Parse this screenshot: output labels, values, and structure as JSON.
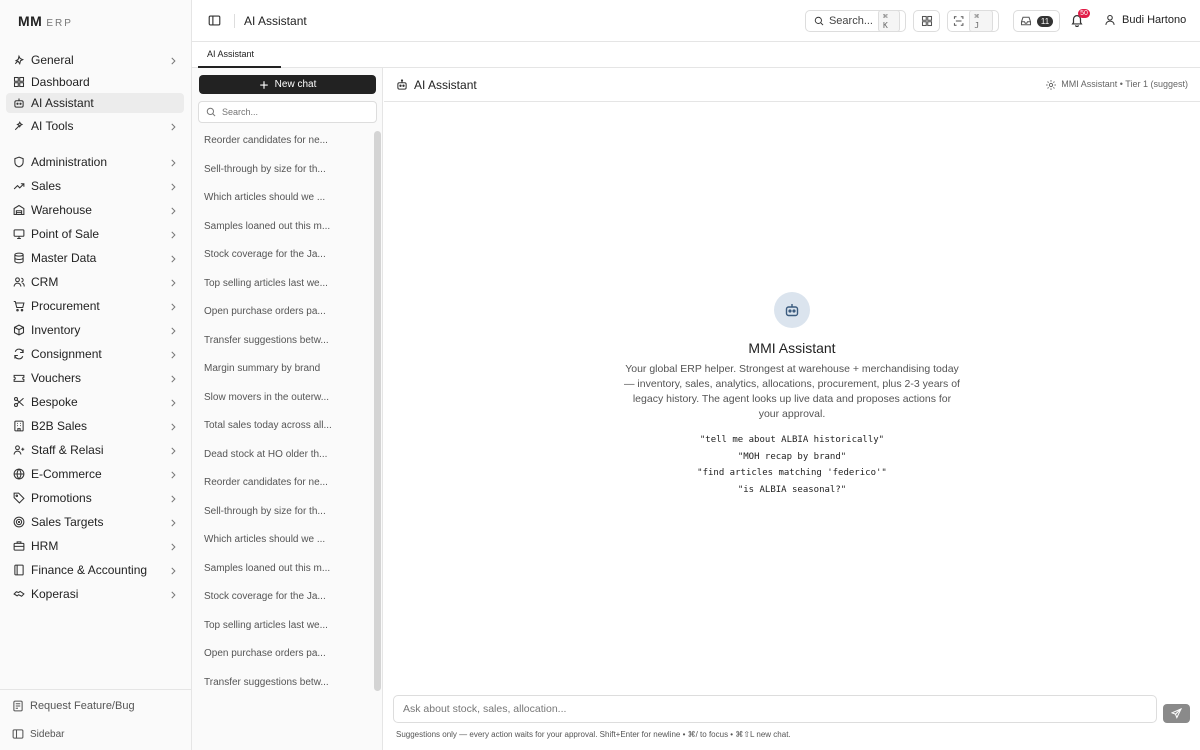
{
  "logo": {
    "main": "MM",
    "sub": "ERP"
  },
  "nav": [
    {
      "label": "General",
      "icon": "general-icon",
      "chevron": true,
      "active": false
    },
    {
      "label": "Dashboard",
      "icon": "dashboard-icon",
      "chevron": false,
      "active": false
    },
    {
      "label": "AI Assistant",
      "icon": "bot-icon",
      "chevron": false,
      "active": true
    },
    {
      "label": "AI Tools",
      "icon": "ai-tools-icon",
      "chevron": true,
      "active": false
    },
    {
      "label": "Administration",
      "icon": "shield-icon",
      "chevron": true,
      "active": false
    },
    {
      "label": "Sales",
      "icon": "trend-icon",
      "chevron": true,
      "active": false
    },
    {
      "label": "Warehouse",
      "icon": "warehouse-icon",
      "chevron": true,
      "active": false
    },
    {
      "label": "Point of Sale",
      "icon": "monitor-icon",
      "chevron": true,
      "active": false
    },
    {
      "label": "Master Data",
      "icon": "database-icon",
      "chevron": true,
      "active": false
    },
    {
      "label": "CRM",
      "icon": "users-icon",
      "chevron": true,
      "active": false
    },
    {
      "label": "Procurement",
      "icon": "cart-icon",
      "chevron": true,
      "active": false
    },
    {
      "label": "Inventory",
      "icon": "box-icon",
      "chevron": true,
      "active": false
    },
    {
      "label": "Consignment",
      "icon": "refresh-icon",
      "chevron": true,
      "active": false
    },
    {
      "label": "Vouchers",
      "icon": "ticket-icon",
      "chevron": true,
      "active": false
    },
    {
      "label": "Bespoke",
      "icon": "scissors-icon",
      "chevron": true,
      "active": false
    },
    {
      "label": "B2B Sales",
      "icon": "building-icon",
      "chevron": true,
      "active": false
    },
    {
      "label": "Staff & Relasi",
      "icon": "user-plus-icon",
      "chevron": true,
      "active": false
    },
    {
      "label": "E-Commerce",
      "icon": "globe-icon",
      "chevron": true,
      "active": false
    },
    {
      "label": "Promotions",
      "icon": "tag-icon",
      "chevron": true,
      "active": false
    },
    {
      "label": "Sales Targets",
      "icon": "target-icon",
      "chevron": true,
      "active": false
    },
    {
      "label": "HRM",
      "icon": "briefcase-icon",
      "chevron": true,
      "active": false
    },
    {
      "label": "Finance & Accounting",
      "icon": "ledger-icon",
      "chevron": true,
      "active": false
    },
    {
      "label": "Koperasi",
      "icon": "handshake-icon",
      "chevron": true,
      "active": false
    }
  ],
  "bottom": {
    "feature": "Request Feature/Bug",
    "sidebar": "Sidebar"
  },
  "header": {
    "title": "AI Assistant",
    "search_label": "Search...",
    "search_kbd": "⌘ K",
    "focus_kbd": "⌘ J",
    "inbox_count": "11",
    "notif_count": "50",
    "user": "Budi Hartono"
  },
  "tabs": [
    {
      "label": "AI Assistant"
    }
  ],
  "chatlist": {
    "new_chat": "New chat",
    "search_placeholder": "Search...",
    "items": [
      "Total sales today across all...",
      "Dead stock at HO older th...",
      "Reorder candidates for ne...",
      "Sell-through by size for th...",
      "Which articles should we ...",
      "Samples loaned out this m...",
      "Stock coverage for the Ja...",
      "Top selling articles last we...",
      "Open purchase orders pa...",
      "Transfer suggestions betw...",
      "Margin summary by brand",
      "Slow movers in the outerw...",
      "Total sales today across all...",
      "Dead stock at HO older th...",
      "Reorder candidates for ne...",
      "Sell-through by size for th...",
      "Which articles should we ...",
      "Samples loaned out this m...",
      "Stock coverage for the Ja...",
      "Top selling articles last we...",
      "Open purchase orders pa...",
      "Transfer suggestions betw..."
    ]
  },
  "main": {
    "title": "AI Assistant",
    "tier": "MMI Assistant • Tier 1 (suggest)",
    "hero_title": "MMI Assistant",
    "hero_desc": "Your global ERP helper. Strongest at warehouse + merchandising today — inventory, sales, analytics, allocations, procurement, plus 2-3 years of legacy history. The agent looks up live data and proposes actions for your approval.",
    "examples": [
      "\"tell me about ALBIA historically\"",
      "\"MOH recap by brand\"",
      "\"find articles matching 'federico'\"",
      "\"is ALBIA seasonal?\""
    ],
    "composer_placeholder": "Ask about stock, sales, allocation...",
    "footnote": "Suggestions only — every action waits for your approval. Shift+Enter for newline • ⌘/ to focus • ⌘⇧L new chat."
  },
  "colors": {
    "primary": "#222222",
    "badge": "#e11d48",
    "avatar_bg": "#dbe4ee",
    "send": "#8a8a8a"
  }
}
